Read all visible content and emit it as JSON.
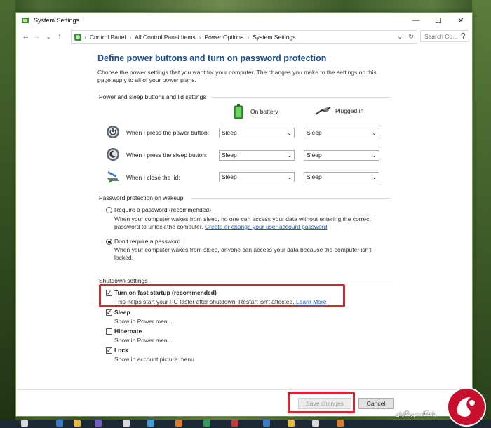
{
  "window": {
    "title": "System Settings"
  },
  "address": {
    "crumbs": [
      "Control Panel",
      "All Control Panel Items",
      "Power Options",
      "System Settings"
    ],
    "search_placeholder": "Search Co..."
  },
  "page": {
    "heading": "Define power buttons and turn on password protection",
    "intro": "Choose the power settings that you want for your computer. The changes you make to the settings on this page apply to all of your power plans."
  },
  "power_group": {
    "label": "Power and sleep buttons and lid settings",
    "on_battery": "On battery",
    "plugged_in": "Plugged in",
    "rows": [
      {
        "label": "When I press the power button:",
        "battery": "Sleep",
        "plugged": "Sleep"
      },
      {
        "label": "When I press the sleep button:",
        "battery": "Sleep",
        "plugged": "Sleep"
      },
      {
        "label": "When I close the lid:",
        "battery": "Sleep",
        "plugged": "Sleep"
      }
    ]
  },
  "password_group": {
    "label": "Password protection on wakeup",
    "require": {
      "title": "Require a password (recommended)",
      "desc": "When your computer wakes from sleep, no one can access your data without entering the correct password to unlock the computer.",
      "link": "Create or change your user account password"
    },
    "dont_require": {
      "title": "Don't require a password",
      "desc": "When your computer wakes from sleep, anyone can access your data because the computer isn't locked."
    }
  },
  "shutdown_group": {
    "label": "Shutdown settings",
    "items": [
      {
        "title": "Turn on fast startup (recommended)",
        "desc": "This helps start your PC faster after shutdown. Restart isn't affected.",
        "link": "Learn More",
        "checked": true
      },
      {
        "title": "Sleep",
        "desc": "Show in Power menu.",
        "checked": true
      },
      {
        "title": "Hibernate",
        "desc": "Show in Power menu.",
        "checked": false
      },
      {
        "title": "Lock",
        "desc": "Show in account picture menu.",
        "checked": true
      }
    ]
  },
  "buttons": {
    "save": "Save changes",
    "cancel": "Cancel"
  },
  "watermark": {
    "text": "باشگاه خبرنگاران"
  },
  "colors": {
    "heading": "#1e4e8c",
    "link": "#1a5fb4",
    "highlight": "#d7262e"
  }
}
